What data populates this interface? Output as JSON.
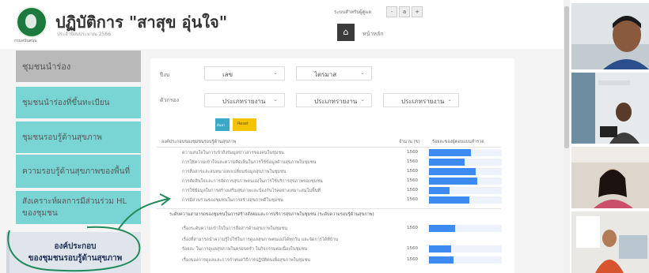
{
  "header": {
    "title": "ปฏิบัติการ \"สาสุข อุ่นใจ\"",
    "subtitle": "ประจำปีงบประมาณ 2566",
    "logo_caption": "กรมสนับสนุน",
    "top_control_label": "ระบบสำหรับผู้ดูแล",
    "breadcrumb": "หน้าหลัก"
  },
  "sidebar": {
    "items": [
      {
        "label": "ชุมชนนำร่อง"
      },
      {
        "label": "ชุมชนนำร่องที่ขึ้นทะเบียน"
      },
      {
        "label": "ชุมชนรอบรู้ด้านสุขภาพ"
      },
      {
        "label": "ความรอบรู้ด้านสุขภาพของพื้นที่"
      },
      {
        "label": "สังเคราะห์ผลการมีส่วนร่วม HL ของชุมชน"
      }
    ],
    "bottom": {
      "line1": "องค์ประกอบ",
      "line2": "ของชุมชนรอบรู้ด้านสุขภาพ"
    }
  },
  "filters": {
    "label1": "ปีงบ",
    "label2": "ตัวกรอง",
    "year_value": "เลข",
    "period_value": "ไตรมาส",
    "region_value": "ประเภทรายงาน",
    "province_value": "ประเภทรายงาน",
    "district_value": "ประเภทรายงาน",
    "search_button": "ค้นหา",
    "reset_button": "Reset"
  },
  "table": {
    "col_topic": "องค์ประกอบของชุมชนรอบรู้ด้านสุขภาพ",
    "col_count": "จำนวน (ข)",
    "col_percent": "ร้อยละของผู้ตอบแบบสำรวจ",
    "rows": [
      {
        "text": "ความสนใจในการเข้าถึงข้อมูลข่าวสารของคนในชุมชน",
        "count": "1560",
        "pct": 0.58
      },
      {
        "text": "การใช้ความเข้าใจและความคิดเห็นในการใช้ข้อมูลด้านสุขภาพในชุมชน",
        "count": "1560",
        "pct": 0.49
      },
      {
        "text": "การสื่อสารและสนทนาแลกเปลี่ยนข้อมูลสุขภาพในชุมชน",
        "count": "1560",
        "pct": 0.64
      },
      {
        "text": "การตัดสินใจและการจัดการสุขภาพตนเองในการใช้บริการสุขภาพของชุมชน",
        "count": "1560",
        "pct": 0.66
      },
      {
        "text": "การใช้ข้อมูลในการสร้างเสริมสุขภาพและป้องกันโรคอย่างเหมาะสมในพื้นที่",
        "count": "1560",
        "pct": 0.28
      },
      {
        "text": "การมีส่วนร่วมของชุมชนในการสร้างสุขภาพดีในชุมชน",
        "count": "1560",
        "pct": 0.55
      }
    ],
    "section2": "ระดับความสามารถของชุมชนในการสร้างสังคมและการบริการสุขภาพในชุมชน (ระดับความรอบรู้ด้านสุขภาพ)",
    "rows2": [
      {
        "text": "เรื่องระดับความเข้าใจในการสื่อสารด้านสุขภาพในชุมชน",
        "count": "1560",
        "pct": 0.36
      },
      {
        "text": "เรื่องที่สามารถนำความรู้ไปใช้ในการดูแลสุขภาพตนเองได้ทุกวัน และจัดการได้ที่บ้าน",
        "count": "",
        "pct": 0
      },
      {
        "text": "ร้อยละ ในการดูแลสุขภาพในครอบครัว ในกิจกรรมต่อเนื่องในชุมชน",
        "count": "1560",
        "pct": 0.3
      },
      {
        "text": "เรื่องของการดูแลและการกำหนดวิธีการปฏิบัติตนเพื่อสุขภาพในชุมชน",
        "count": "1560",
        "pct": 0.34
      }
    ]
  },
  "colors": {
    "sidebar_teal": "#79d4d4",
    "bar_blue": "#3d8bf0",
    "reset_yellow": "#f4c400",
    "search_blue": "#3ca8c8",
    "annotation_green": "#1f8a5a"
  },
  "icons": {
    "home": "home-icon",
    "logo": "ministry-logo-icon"
  }
}
